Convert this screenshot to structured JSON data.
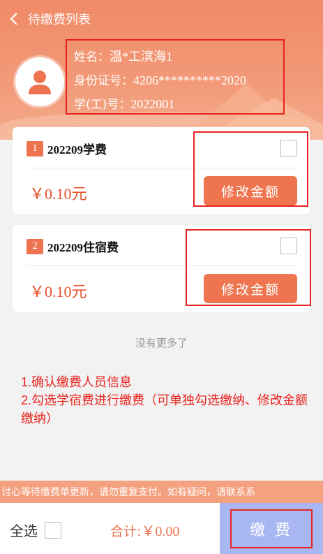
{
  "nav": {
    "title": "待缴费列表"
  },
  "user": {
    "name_label": "姓名：",
    "name_value": "温*工滨海1",
    "id_label": "身份证号：",
    "id_value": "4206**********2020",
    "student_label": "学(工)号：",
    "student_value": "2022001"
  },
  "items": [
    {
      "num": "1",
      "name": "202209学费",
      "amount": "￥0.10元",
      "modify_label": "修改金额"
    },
    {
      "num": "2",
      "name": "202209住宿费",
      "amount": "￥0.10元",
      "modify_label": "修改金额"
    }
  ],
  "no_more": "没有更多了",
  "note": {
    "line1": "1.确认缴费人员信息",
    "line2": "2.勾选学宿费进行缴费（可单独勾选缴纳、修改金额缴纳）"
  },
  "notice": "讨心等待缴费单更新，请勿重复支付。如有疑问，请联系系",
  "footer": {
    "select_all": "全选",
    "total_label": "合计:",
    "total_value": "￥0.00",
    "pay_label": "缴 费"
  },
  "colors": {
    "accent": "#ef7450",
    "pay_bg": "#a8b7f2",
    "highlight": "#e8231f"
  }
}
